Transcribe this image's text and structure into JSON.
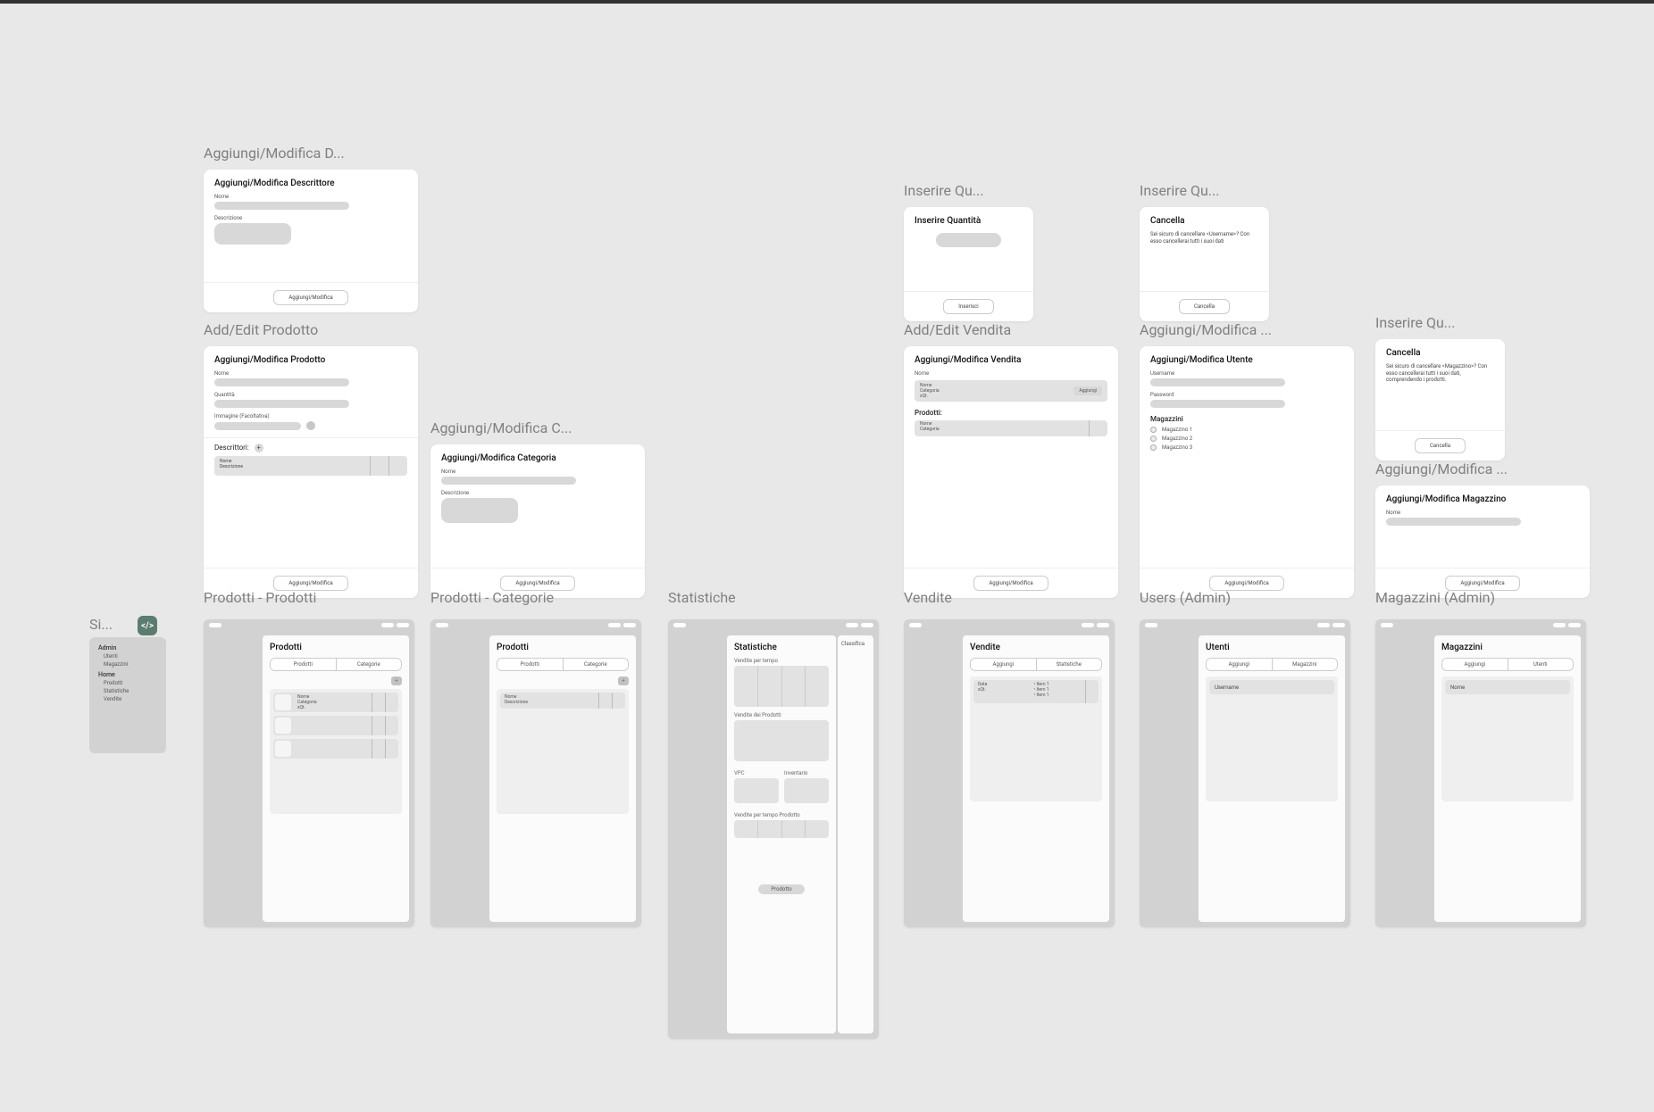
{
  "titles": {
    "descrittore": "Aggiungi/Modifica D...",
    "add_prodotto": "Add/Edit Prodotto",
    "categoria": "Aggiungi/Modifica C...",
    "inserire_q1": "Inserire Qu...",
    "inserire_q2": "Inserire Qu...",
    "inserire_q3": "Inserire Qu...",
    "add_vendita": "Add/Edit Vendita",
    "utente": "Aggiungi/Modifica ...",
    "magazzino_t": "Aggiungi/Modifica ...",
    "prodotti_prodotti": "Prodotti - Prodotti",
    "prodotti_categorie": "Prodotti - Categorie",
    "statistiche": "Statistiche",
    "vendite": "Vendite",
    "users": "Users (Admin)",
    "magazzini": "Magazzini (Admin)",
    "sidebar": "Si..."
  },
  "descrittore": {
    "title": "Aggiungi/Modifica Descrittore",
    "f_nome": "Nome",
    "f_descr": "Descrizione",
    "action": "Aggiungi/Modifica"
  },
  "prodotto": {
    "title": "Aggiungi/Modifica Prodotto",
    "f_nome": "Nome",
    "f_qta": "Quantità",
    "f_img": "Immagine (Facoltativa)",
    "section": "Descrittori:",
    "card_nome": "Nome",
    "card_desc": "Descrizione",
    "action": "Aggiungi/Modifica"
  },
  "categoria": {
    "title": "Aggiungi/Modifica Categoria",
    "f_nome": "Nome",
    "f_descr": "Descrizione",
    "action": "Aggiungi/Modifica"
  },
  "inserisci": {
    "title": "Inserire Quantità",
    "action": "Inserisci"
  },
  "cancella_user": {
    "title": "Cancella",
    "msg": "Sei sicuro di cancellare <Username>? Con esso cancellerai tutti i suoi dati",
    "action": "Cancella"
  },
  "cancella_mag": {
    "title": "Cancella",
    "msg": "Sei sicuro di cancellare <Magazzino>? Con esso cancellerai tutti i suoi dati, comprendendo i prodotti.",
    "action": "Cancella"
  },
  "vendita": {
    "title": "Aggiungi/Modifica Vendita",
    "f_nome": "Nome",
    "row_nome": "Nome",
    "row_cat": "Categoria",
    "row_qt": "xQt.",
    "row_btn": "Aggiungi",
    "section": "Prodotti:",
    "item_nome": "Nome",
    "item_cat": "Categoria",
    "action": "Aggiungi/Modifica"
  },
  "utente": {
    "title": "Aggiungi/Modifica Utente",
    "f_user": "Username",
    "f_pass": "Password",
    "section": "Magazzini",
    "opts": [
      "Magazzino 1",
      "Magazzino 2",
      "Magazzino 3"
    ],
    "action": "Aggiungi/Modifica"
  },
  "magazzino": {
    "title": "Aggiungi/Modifica Magazzino",
    "f_nome": "Nome",
    "action": "Aggiungi/Modifica"
  },
  "screens": {
    "prodotti": {
      "title": "Prodotti",
      "seg": [
        "Prodotti",
        "Categorie"
      ],
      "card_nome": "Nome",
      "card_cat": "Categoria",
      "card_qt": "xQt."
    },
    "categorie": {
      "title": "Prodotti",
      "seg": [
        "Prodotti",
        "Categorie"
      ],
      "card_nome": "Nome",
      "card_desc": "Descrizione"
    },
    "stats": {
      "title": "Statistiche",
      "side": "Classifica",
      "s1": "Vendite per tempo",
      "s2": "Vendite dei Prodotti",
      "s3a": "VPC",
      "s3b": "Inventario",
      "s4": "Vendite per tempo Prodotto",
      "btn": "Prodotto"
    },
    "vendite": {
      "title": "Vendite",
      "seg": [
        "Aggiungi",
        "Statistiche"
      ],
      "col1": "Data",
      "col2": "xQt.",
      "items": [
        "Item 1",
        "Item 1",
        "Item 1"
      ]
    },
    "users": {
      "title": "Utenti",
      "seg": [
        "Aggiungi",
        "Magazzini"
      ],
      "row": "Username"
    },
    "magazzini": {
      "title": "Magazzini",
      "seg": [
        "Aggiungi",
        "Utenti"
      ],
      "row": "Nome"
    }
  },
  "sidebar": {
    "h1": "Admin",
    "i1": "Utenti",
    "i2": "Magazzini",
    "h2": "Home",
    "i3": "Prodotti",
    "i4": "Statistiche",
    "i5": "Vendite"
  }
}
